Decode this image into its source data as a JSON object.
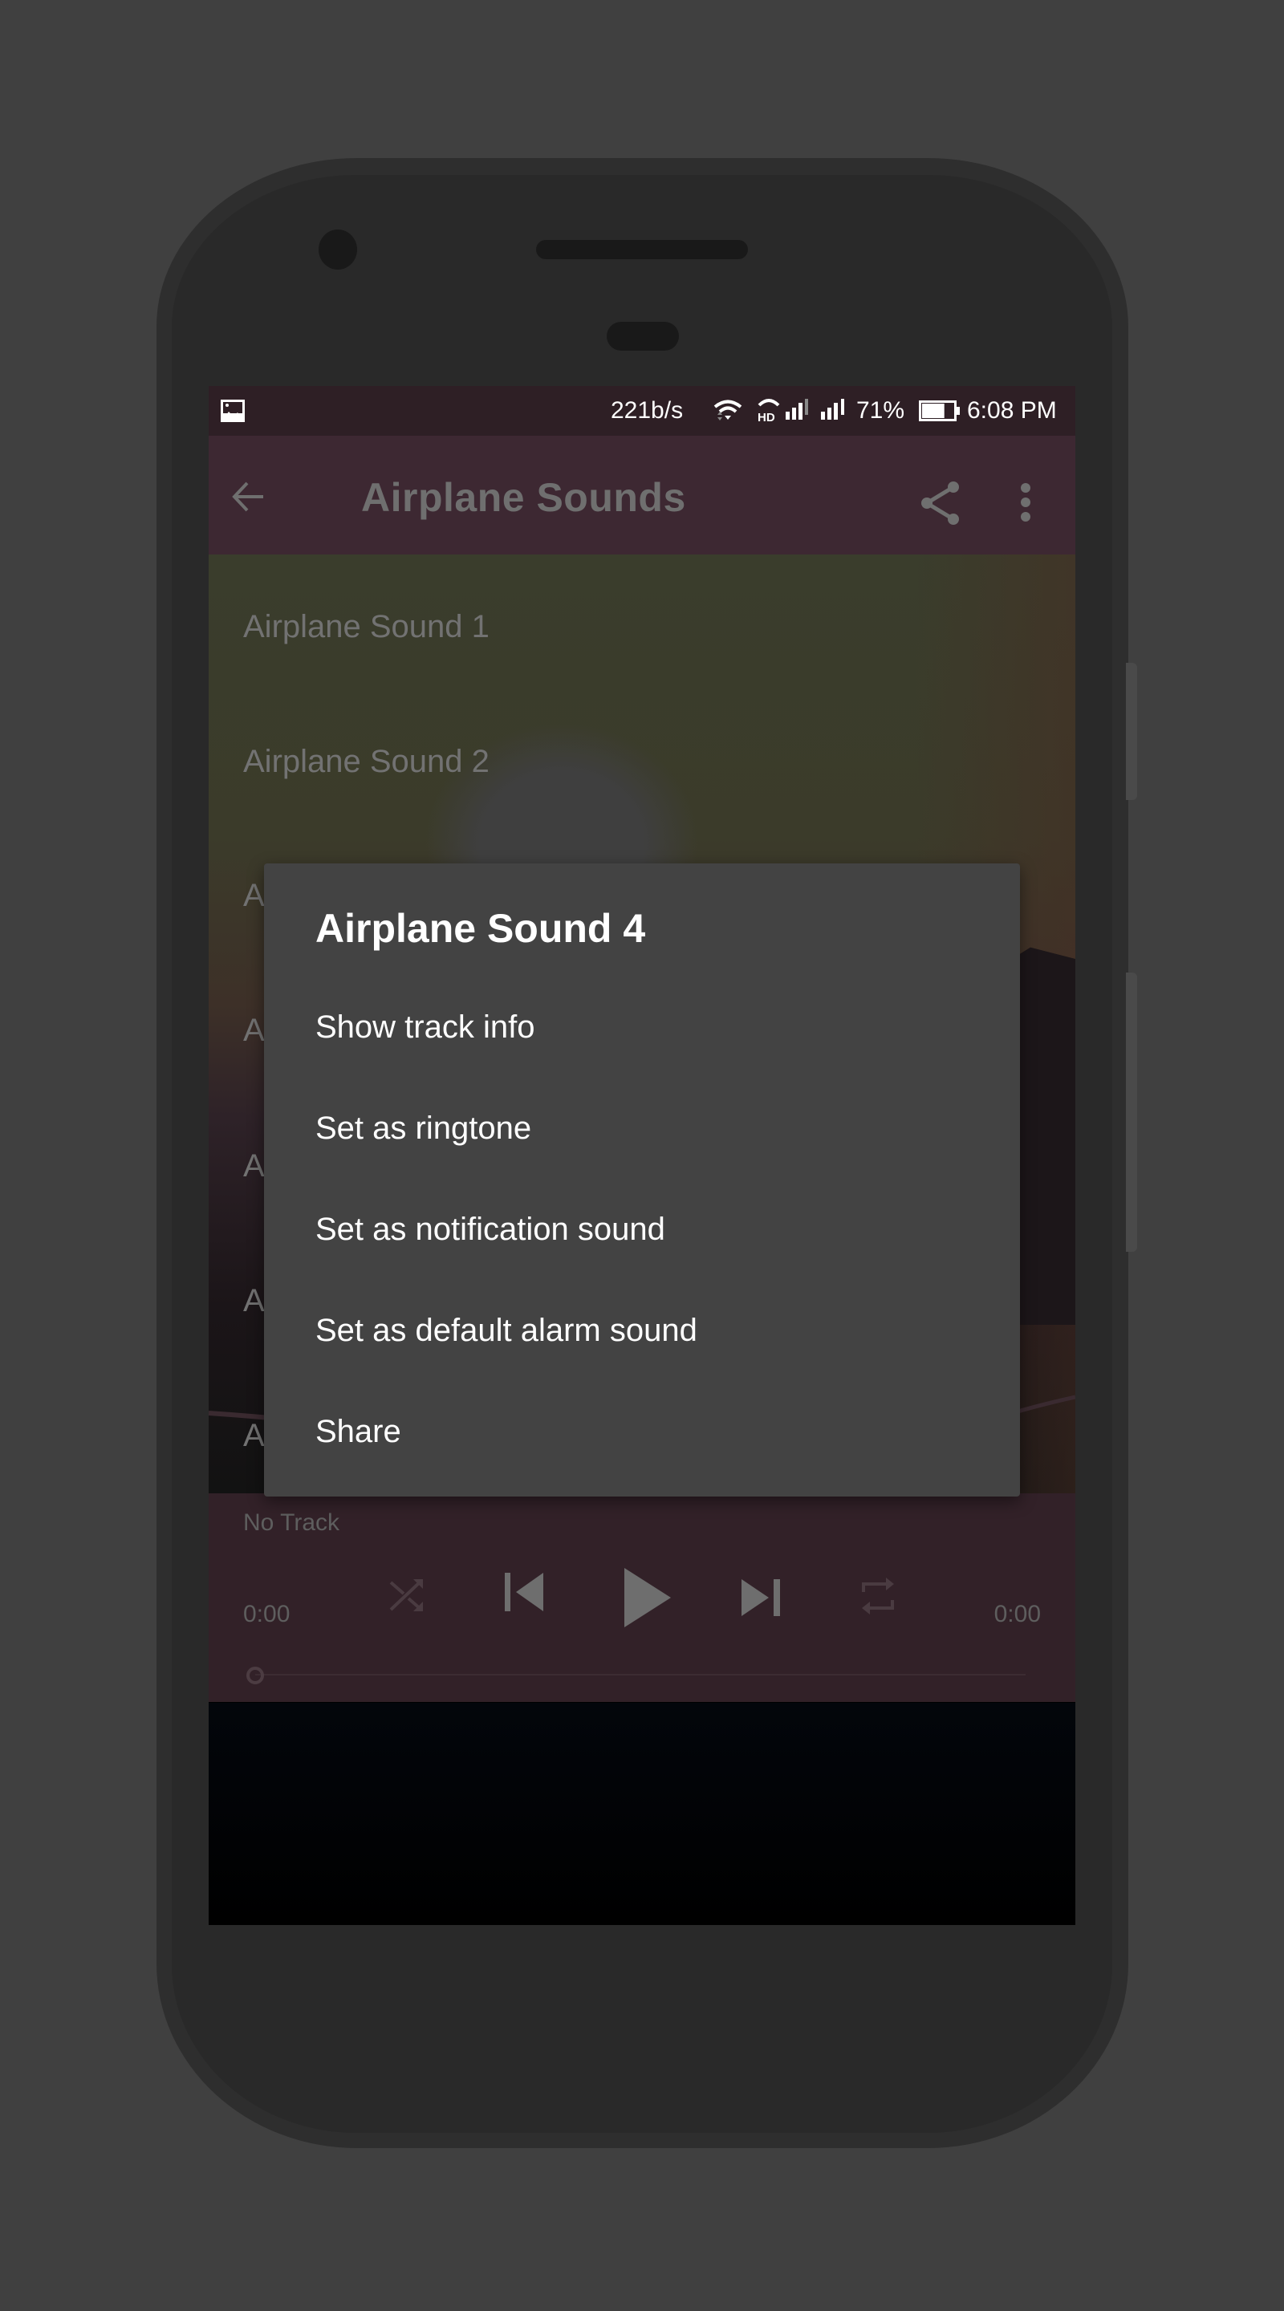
{
  "status_bar": {
    "notification_icon": "image-icon",
    "network_speed": "221b/s",
    "wifi_icon": "wifi-icon",
    "hd_call_icon": "hd-voice-icon",
    "signal_sim1_icon": "signal-icon",
    "signal_sim2_icon": "signal-icon",
    "battery_percent": "71%",
    "battery_level": 0.71,
    "time": "6:08 PM"
  },
  "toolbar": {
    "back_icon": "arrow-left-icon",
    "title": "Airplane Sounds",
    "share_icon": "share-icon",
    "more_icon": "more-vert-icon"
  },
  "track_list": {
    "items": [
      {
        "label": "Airplane Sound 1"
      },
      {
        "label": "Airplane Sound 2"
      },
      {
        "label": "A"
      },
      {
        "label": "A"
      },
      {
        "label": "A"
      },
      {
        "label": "A"
      },
      {
        "label": "A"
      }
    ]
  },
  "dialog": {
    "title": "Airplane Sound 4",
    "items": [
      {
        "label": "Show track info"
      },
      {
        "label": "Set as ringtone"
      },
      {
        "label": "Set as notification sound"
      },
      {
        "label": "Set as default alarm sound"
      },
      {
        "label": "Share"
      }
    ]
  },
  "player": {
    "track_name": "No Track",
    "elapsed": "0:00",
    "duration": "0:00",
    "progress": 0,
    "controls": {
      "shuffle_icon": "shuffle-icon",
      "previous_icon": "skip-previous-icon",
      "play_icon": "play-icon",
      "next_icon": "skip-next-icon",
      "repeat_icon": "repeat-icon"
    }
  },
  "colors": {
    "status_bar": "#2e1f25",
    "toolbar": "#3d2832",
    "dialog_bg": "#434343",
    "dialog_text": "#ffffff",
    "dim_text": "#727272"
  }
}
